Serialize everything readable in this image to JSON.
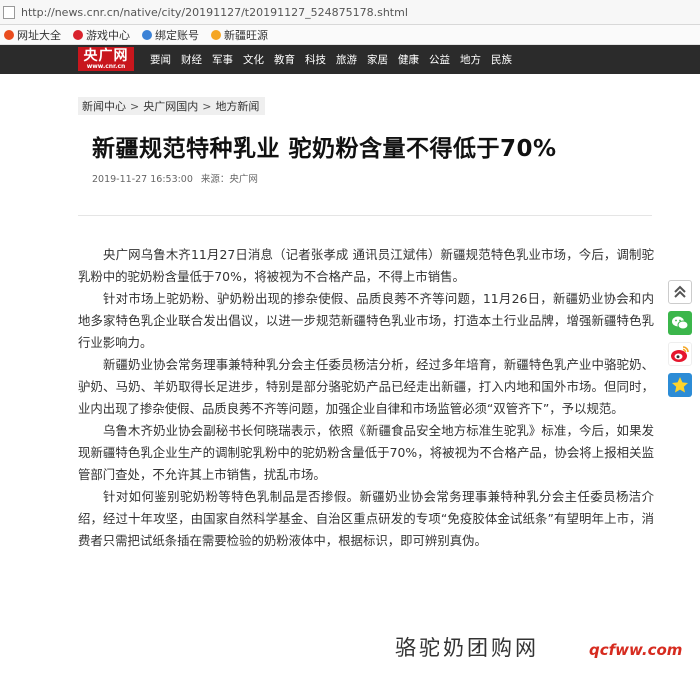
{
  "browser": {
    "url": "http://news.cnr.cn/native/city/20191127/t20191127_524875178.shtml",
    "bookmarks": [
      {
        "label": "网址大全",
        "icon": "site-icon"
      },
      {
        "label": "游戏中心",
        "icon": "game-icon"
      },
      {
        "label": "绑定账号",
        "icon": "link-icon"
      },
      {
        "label": "新疆旺源",
        "icon": "bookmark-icon"
      }
    ]
  },
  "header": {
    "logo_cn": "央广网",
    "logo_en": "www.cnr.cn",
    "nav": [
      "要闻",
      "财经",
      "军事",
      "文化",
      "教育",
      "科技",
      "旅游",
      "家居",
      "健康",
      "公益",
      "地方",
      "民族"
    ]
  },
  "breadcrumb": [
    "新闻中心",
    "央广网国内",
    "地方新闻"
  ],
  "article": {
    "title": "新疆规范特种乳业 驼奶粉含量不得低于70%",
    "date": "2019-11-27 16:53:00",
    "source": "来源：央广网",
    "paragraphs": [
      "央广网乌鲁木齐11月27日消息（记者张孝成 通讯员江斌伟）新疆规范特色乳业市场，今后，调制驼乳粉中的驼奶粉含量低于70%，将被视为不合格产品，不得上市销售。",
      "针对市场上驼奶粉、驴奶粉出现的掺杂使假、品质良莠不齐等问题，11月26日，新疆奶业协会和内地多家特色乳企业联合发出倡议，以进一步规范新疆特色乳业市场，打造本土行业品牌，增强新疆特色乳行业影响力。",
      "新疆奶业协会常务理事兼特种乳分会主任委员杨洁分析，经过多年培育，新疆特色乳产业中骆驼奶、驴奶、马奶、羊奶取得长足进步，特别是部分骆驼奶产品已经走出新疆，打入内地和国外市场。但同时，业内出现了掺杂使假、品质良莠不齐等问题，加强企业自律和市场监管必须“双管齐下”，予以规范。",
      "乌鲁木齐奶业协会副秘书长何晓瑞表示，依照《新疆食品安全地方标准生驼乳》标准，今后，如果发现新疆特色乳企业生产的调制驼乳粉中的驼奶粉含量低于70%，将被视为不合格产品，协会将上报相关监管部门查处，不允许其上市销售，扰乱市场。",
      "针对如何鉴别驼奶粉等特色乳制品是否掺假。新疆奶业协会常务理事兼特种乳分会主任委员杨洁介绍，经过十年攻坚，由国家自然科学基金、自治区重点研发的专项“免疫胶体金试纸条”有望明年上市，消费者只需把试纸条插在需要检验的奶粉液体中，根据标识，即可辨别真伪。"
    ]
  },
  "sidebar": [
    "back-to-top-icon",
    "wechat-icon",
    "weibo-icon",
    "qzone-icon"
  ],
  "watermark": {
    "cn": "骆驼奶团购网",
    "url": "qcfww.com"
  },
  "colors": {
    "nav_bg": "#2b2b2b",
    "logo_red": "#c8161d",
    "wechat_green": "#3bb64b",
    "weibo_red": "#e6162d",
    "qzone_blue": "#2c8cd6"
  }
}
